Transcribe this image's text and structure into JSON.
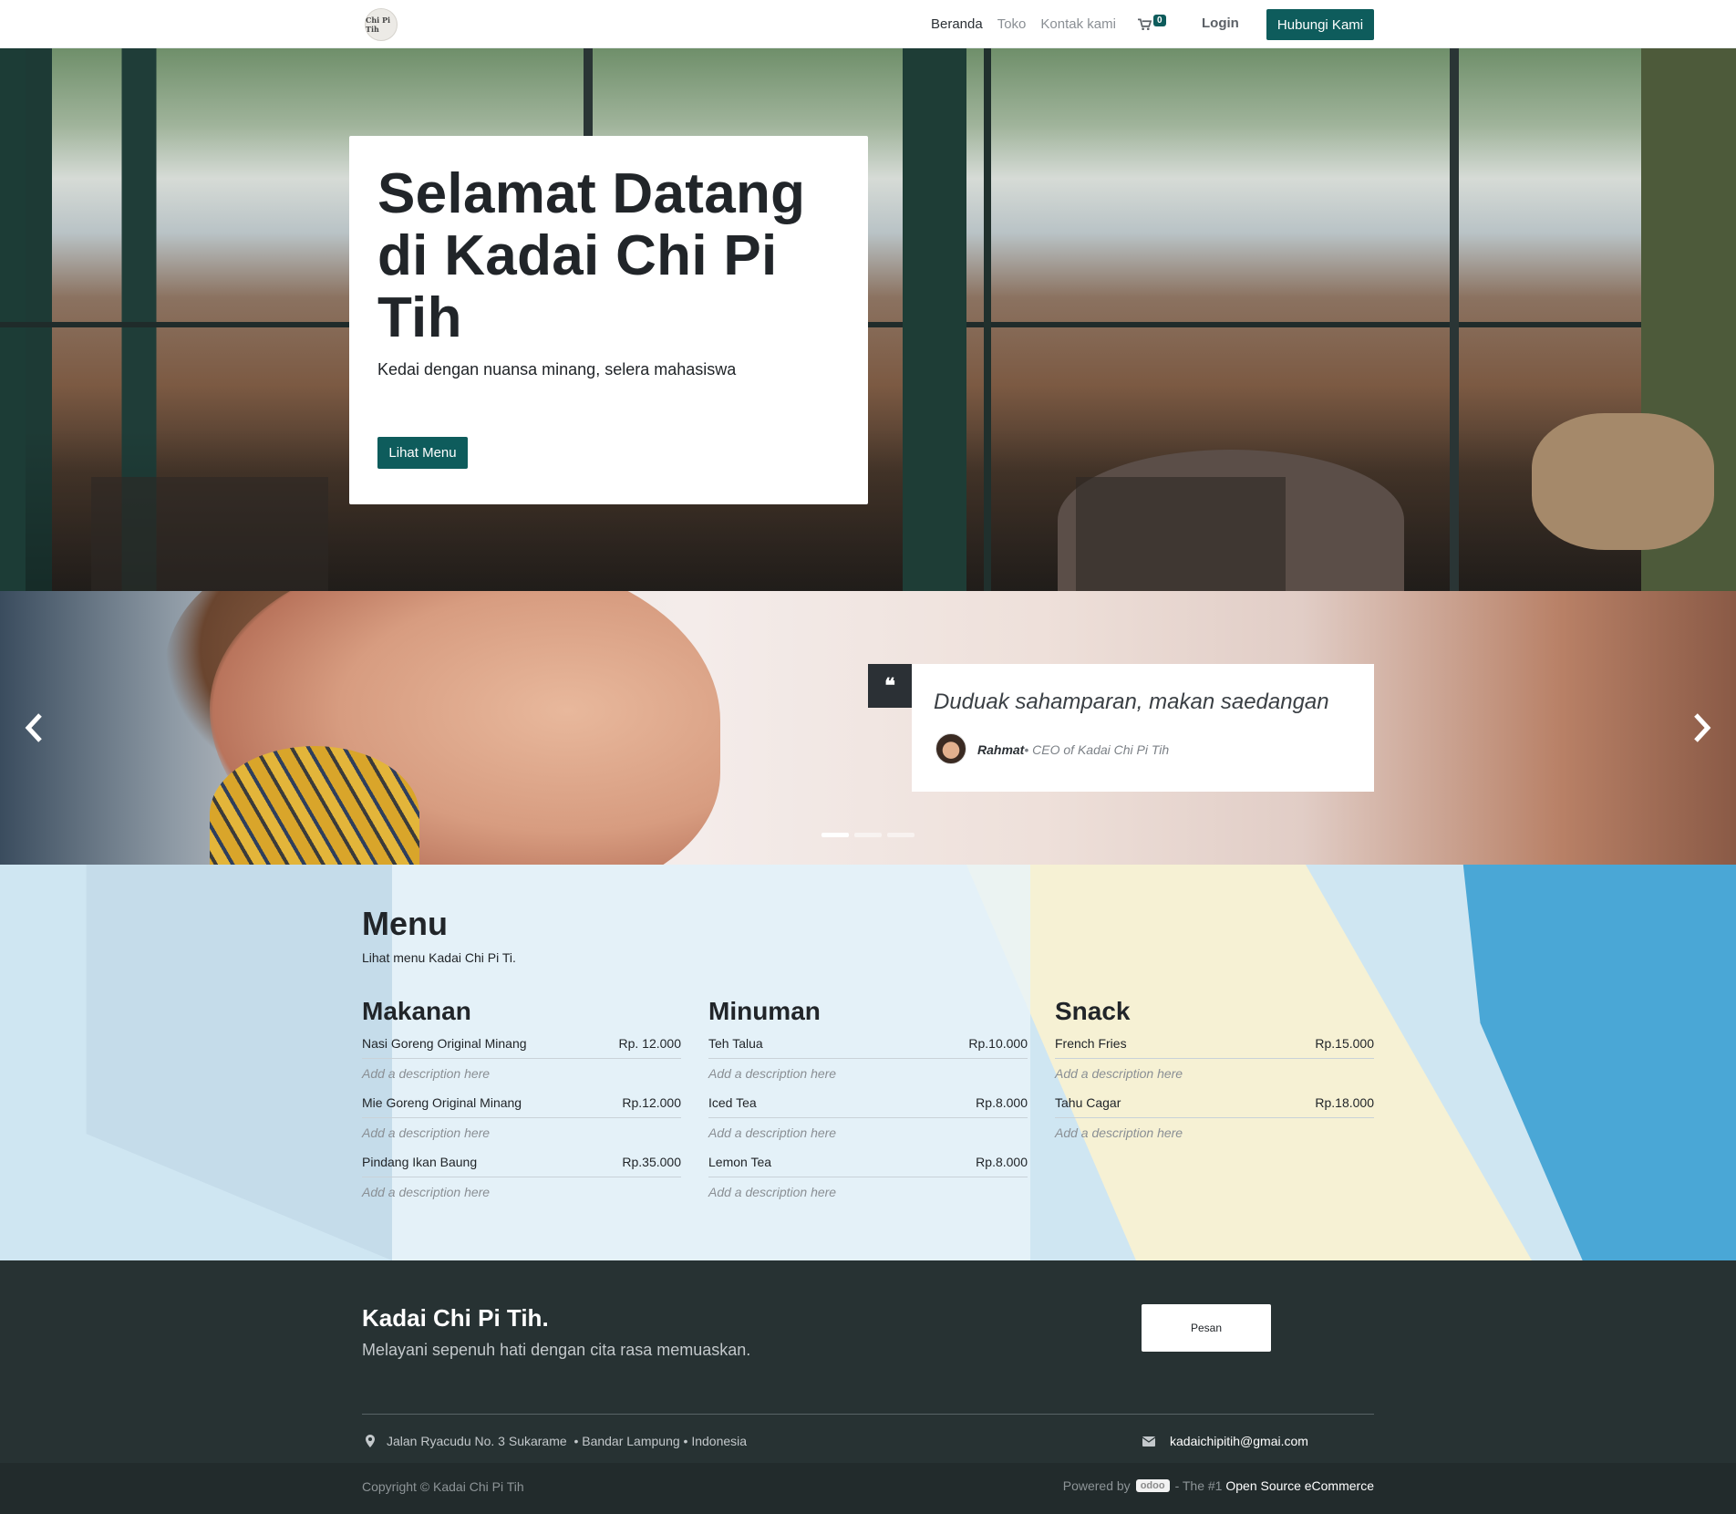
{
  "brand": {
    "logo_text": "Chi Pi Tih"
  },
  "colors": {
    "primary": "#0e5c5c",
    "footer_bg": "#273233",
    "copyright_bg": "#222b2c"
  },
  "nav": {
    "links": [
      "Beranda",
      "Toko",
      "Kontak kami"
    ],
    "cart_icon": "shopping-cart-icon",
    "cart_count": "0",
    "login": "Login",
    "cta": "Hubungi Kami"
  },
  "hero": {
    "title": "Selamat Datang di Kadai Chi Pi Tih",
    "subtitle": "Kedai dengan nuansa minang, selera mahasiswa",
    "button": "Lihat Menu"
  },
  "testimonial": {
    "quote_icon": "quote-icon",
    "quote": "Duduak sahamparan, makan saedangan",
    "author": "Rahmat",
    "role": "• CEO of Kadai Chi Pi Tih",
    "slide_count": 3,
    "active_slide": 1
  },
  "menu": {
    "title": "Menu",
    "subtitle": "Lihat menu Kadai Chi Pi Ti.",
    "columns": [
      {
        "title": "Makanan",
        "items": [
          {
            "name": "Nasi Goreng Original Minang",
            "price": "Rp. 12.000",
            "desc": "Add a description here"
          },
          {
            "name": "Mie Goreng Original Minang",
            "price": "Rp.12.000",
            "desc": "Add a description here"
          },
          {
            "name": "Pindang Ikan Baung",
            "price": "Rp.35.000",
            "desc": "Add a description here"
          }
        ]
      },
      {
        "title": "Minuman",
        "items": [
          {
            "name": "Teh Talua",
            "price": "Rp.10.000",
            "desc": "Add a description here"
          },
          {
            "name": "Iced Tea",
            "price": "Rp.8.000",
            "desc": "Add a description here"
          },
          {
            "name": "Lemon Tea",
            "price": "Rp.8.000",
            "desc": "Add a description here"
          }
        ]
      },
      {
        "title": "Snack",
        "items": [
          {
            "name": "French Fries",
            "price": "Rp.15.000",
            "desc": "Add a description here"
          },
          {
            "name": "Tahu Cagar",
            "price": "Rp.18.000",
            "desc": "Add a description here"
          }
        ]
      }
    ]
  },
  "footer": {
    "title": "Kadai Chi Pi Tih.",
    "subtitle": "Melayani sepenuh hati dengan cita rasa memuaskan.",
    "button": "Pesan",
    "address": "Jalan Ryacudu No. 3 Sukarame  • Bandar Lampung • Indonesia",
    "email": "kadaichipitih@gmai.com",
    "copyright": "Copyright © Kadai Chi Pi Tih",
    "powered_prefix": "Powered by",
    "powered_badge": "odoo",
    "powered_middle": "- The #1",
    "powered_link": "Open Source eCommerce"
  }
}
